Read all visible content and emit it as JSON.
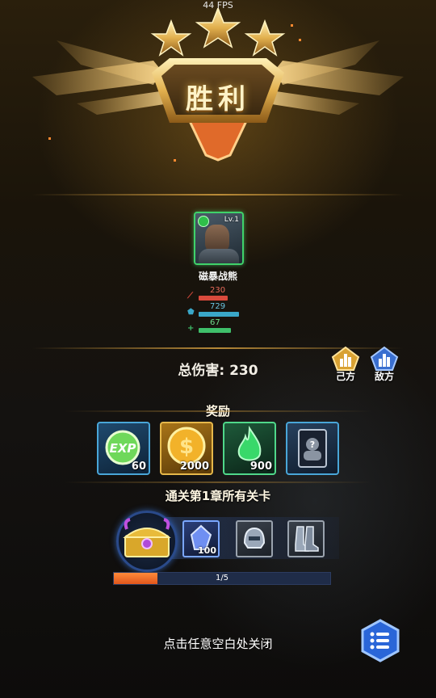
{
  "fps": "44 FPS",
  "title": "胜利",
  "stars": 3,
  "hero": {
    "level": "Lv.1",
    "name": "磁暴战熊",
    "stats": [
      {
        "icon": "sword-icon",
        "value": "230",
        "color": "#d94a3c",
        "fraction": 0.45
      },
      {
        "icon": "shield-icon",
        "value": "729",
        "color": "#3aa7c8",
        "fraction": 0.62
      },
      {
        "icon": "heal-icon",
        "value": "67",
        "color": "#3fbf6a",
        "fraction": 0.5
      }
    ]
  },
  "total_damage": "总伤害: 230",
  "buttons": {
    "our_side": "己方",
    "enemy_side": "敌方"
  },
  "rewards_label": "奖励",
  "rewards": [
    {
      "icon": "exp-icon",
      "amount": "60"
    },
    {
      "icon": "gold-coin-icon",
      "amount": "2000"
    },
    {
      "icon": "green-flame-icon",
      "amount": "900"
    },
    {
      "icon": "mystery-card-icon",
      "amount": ""
    }
  ],
  "chapter_label": "通关第1章所有关卡",
  "chapter_items": [
    {
      "icon": "crystal-icon",
      "amount": "100"
    },
    {
      "icon": "helmet-icon",
      "amount": ""
    },
    {
      "icon": "boots-icon",
      "amount": ""
    }
  ],
  "progress": {
    "text": "1/5",
    "fraction": 0.2
  },
  "close_tip": "点击任意空白处关闭",
  "colors": {
    "accent_gold": "#e0b04a",
    "progress_fill": "#f07030",
    "reward_border": "#49a6d8"
  }
}
